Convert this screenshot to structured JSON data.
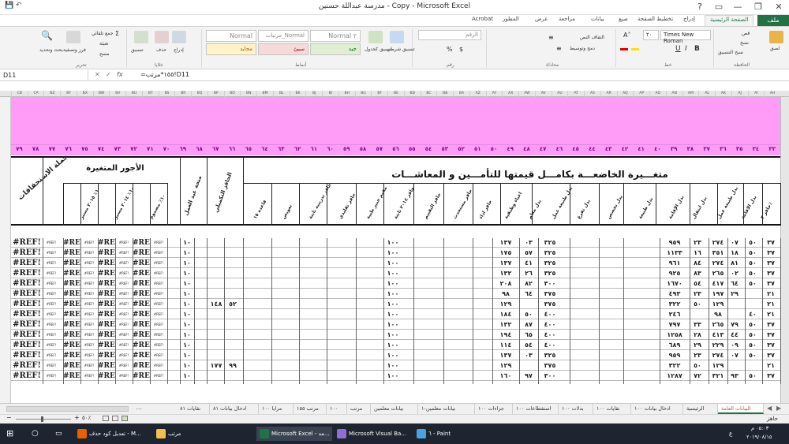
{
  "window": {
    "title": "مدرسة عبداللة حسنين - Copy - Microsoft Excel",
    "minimize": "—",
    "restore": "❐",
    "close": "✕",
    "help": "?",
    "ribbon_options": "▭"
  },
  "ribbon_tabs": [
    "ملف",
    "الصفحة الرئيسية",
    "إدراج",
    "تخطيط الصفحة",
    "صيغ",
    "بيانات",
    "مراجعة",
    "عرض",
    "المطور",
    "Acrobat"
  ],
  "ribbon": {
    "clipboard": {
      "label": "الحافظة",
      "paste": "لصق",
      "cut": "قص",
      "copy": "نسخ",
      "format_painter": "نسخ التنسيق"
    },
    "font": {
      "label": "خط",
      "name": "Times New Roman",
      "size": "٢٠"
    },
    "alignment": {
      "label": "محاذاة",
      "wrap": "التفاف النص",
      "merge": "دمج وتوسيط"
    },
    "number": {
      "label": "رقم",
      "format": "الرقم"
    },
    "styles": {
      "label": "أنماط",
      "conditional": "تنسيق شرطي",
      "as_table": "تنسيق كجدول",
      "normal": "Normal",
      "normal_2": "Normal ٢",
      "normal_salaries": "مرتبات_Normal",
      "good": "جيد",
      "bad": "سيئ",
      "neutral": "محايد"
    },
    "cells": {
      "label": "خلايا",
      "insert": "إدراج",
      "delete": "حذف",
      "format": "تنسيق"
    },
    "editing": {
      "label": "تحرير",
      "autosum": "جمع تلقائي",
      "fill": "تعبئة",
      "clear": "مسح",
      "sort": "فرز وتصفية",
      "find": "بحث وتحديد"
    }
  },
  "formula_bar": {
    "name_box": "D11",
    "formula": "=١٥٥*مرتب!D11",
    "fx": "fx"
  },
  "column_letters": [
    "AH",
    "AI",
    "AJ",
    "AK",
    "AL",
    "AM",
    "AN",
    "AO",
    "AP",
    "AQ",
    "AR",
    "AS",
    "AT",
    "AU",
    "AV",
    "AW",
    "AX",
    "AY",
    "AZ",
    "BA",
    "BB",
    "BC",
    "BD",
    "BE",
    "BF",
    "BG",
    "BH",
    "BI",
    "BJ",
    "BK",
    "BL",
    "BM",
    "BN",
    "BO",
    "BP",
    "BQ",
    "BR",
    "BS",
    "BT",
    "BU",
    "BV",
    "BW",
    "BX",
    "BY",
    "BZ",
    "CA",
    "CB"
  ],
  "col_numbers": [
    "٣٣",
    "٣٤",
    "٣٥",
    "٣٦",
    "٣٧",
    "٣٨",
    "٣٩",
    "٤٠",
    "٤١",
    "٤٢",
    "٤٣",
    "٤٤",
    "٤٥",
    "٤٦",
    "٤٧",
    "٤٨",
    "٤٩",
    "٥٠",
    "٥١",
    "٥٢",
    "٥٣",
    "٥٤",
    "٥٥",
    "٥٦",
    "٥٧",
    "٥٨",
    "٥٩",
    "٦٠",
    "٦١",
    "٦٢",
    "٦٣",
    "٦٤",
    "٦٥",
    "٦٦",
    "٦٧",
    "٦٨",
    "٦٩",
    "٧٠",
    "٧١",
    "٧٢",
    "٧٣",
    "٧٤",
    "٧٥",
    "٧٦",
    "٧٧",
    "٧٨",
    "٧٩"
  ],
  "header": {
    "main_title": "متغـــيرة الخاضعـــة بكامـــل قيمتها للتأمـــين و المعاشـــات",
    "variable_wages": "الأجور المتغيرة",
    "total_benefits": "جملة الاستحقاقات",
    "teaching_grant": "منحة عيد العمل",
    "incentive": "الحافز التكميلي",
    "subcols": [
      "حافز ٣٪",
      "بدل الاقامة",
      "بدل طبيعة عمل",
      "بدل انتقال",
      "بدل الإقامة",
      "بدل طبيعة",
      "بدل تخصص",
      "بدل تفرغ",
      "بدل طبيعة عمل",
      "بدل معلم",
      "اعباء وظيفية",
      "حافز اداء",
      "حافز مستحدث",
      "حافز التقييم",
      "حافز ٢٠١٤ ثابتة",
      "مقيم خبير طبية",
      "حافز تقليدي",
      "حافز تدريبية ثابتة",
      "تعويض",
      "قاعدة ١٥",
      "حافز تطوير",
      "حافز خاص",
      "حافز امتحانات",
      "حافز ريفي"
    ],
    "wage_subcols": [
      "١٠٪ مضموم",
      "١٠٪ ٢٠١٤ مسير",
      "١٠٪ ٢٠١٥ مسير"
    ]
  },
  "rows": [
    {
      "a": "٣٧",
      "b": "٥٠",
      "c": "٢٧٤",
      "d": "٠٧",
      "e": "٩٥٩",
      "f": "٢٣",
      "g": "٣٢٥",
      "h": "٠٣",
      "i": "١٣٧",
      "bonus": "١٠٠",
      "grant": "١٠",
      "inc": "",
      "inc2": ""
    },
    {
      "a": "٣٧",
      "b": "٥٠",
      "c": "٣٥١",
      "d": "١٨",
      "e": "١١٣٣",
      "f": "١٦",
      "g": "٣٢٥",
      "h": "٥٧",
      "i": "١٧٥",
      "bonus": "١٠٠",
      "grant": "١٠",
      "inc": "",
      "inc2": ""
    },
    {
      "a": "٣٧",
      "b": "٥٠",
      "c": "٢٧٤",
      "d": "٨١",
      "e": "٩٦١",
      "f": "٨٤",
      "g": "٣٢٥",
      "h": "٤١",
      "i": "١٣٧",
      "bonus": "١٠٠",
      "grant": "١٠",
      "inc": "",
      "inc2": ""
    },
    {
      "a": "٣٧",
      "b": "٥٠",
      "c": "٢٦٥",
      "d": "٠٢",
      "e": "٩٢٥",
      "f": "٨٣",
      "g": "٣٢٥",
      "h": "٢٦",
      "i": "١٣٢",
      "bonus": "١٠٠",
      "grant": "١٠",
      "inc": "",
      "inc2": ""
    },
    {
      "a": "٣٧",
      "b": "٥٠",
      "c": "٤١٧",
      "d": "٦٤",
      "e": "١٦٧٠",
      "f": "٥٤",
      "g": "٣٠٠",
      "h": "٨٢",
      "i": "٢٠٨",
      "bonus": "١٠٠",
      "grant": "١٠",
      "inc": "",
      "inc2": ""
    },
    {
      "a": "٢١",
      "b": "",
      "c": "١٩٧",
      "d": "٢٩",
      "e": "٤٩٣",
      "f": "٢٣",
      "g": "٣٧٥",
      "h": "٦٤",
      "i": "٩٨",
      "bonus": "١٠٠",
      "grant": "١٠",
      "inc": "",
      "inc2": ""
    },
    {
      "a": "٢١",
      "b": "",
      "c": "١٢٩",
      "d": "",
      "e": "٣٢٢",
      "f": "٥٠",
      "g": "٣٧٥",
      "h": "",
      "i": "١٢٩",
      "bonus": "١٠٠",
      "grant": "١٠",
      "inc": "٥٢",
      "inc2": "١٤٨"
    },
    {
      "a": "٢١",
      "b": "٤٠",
      "c": "٩٨",
      "d": "",
      "e": "٢٤٦",
      "f": "",
      "g": "٤٠٠",
      "h": "٥٠",
      "i": "١٨٤",
      "bonus": "١٠٠",
      "grant": "١٠",
      "inc": "",
      "inc2": ""
    },
    {
      "a": "٣٧",
      "b": "٥٠",
      "c": "٢٦٥",
      "d": "٧٩",
      "e": "٧٩٧",
      "f": "٣٣",
      "g": "٤٠٠",
      "h": "٨٧",
      "i": "١٣٢",
      "bonus": "١٠٠",
      "grant": "١٠",
      "inc": "",
      "inc2": ""
    },
    {
      "a": "٣٧",
      "b": "٥٠",
      "c": "٤١٣",
      "d": "٤٤",
      "e": "١٢٥٨",
      "f": "٢٨",
      "g": "٤٠٠",
      "h": "٦٥",
      "i": "١٩٤",
      "bonus": "١٠٠",
      "grant": "١٠",
      "inc": "",
      "inc2": ""
    },
    {
      "a": "٣٧",
      "b": "٥٠",
      "c": "٢٢٩",
      "d": "٠٩",
      "e": "٦٨٩",
      "f": "٢٩",
      "g": "٤٠٠",
      "h": "٥٤",
      "i": "١١٤",
      "bonus": "١٠٠",
      "grant": "١٠",
      "inc": "",
      "inc2": ""
    },
    {
      "a": "٣٧",
      "b": "٥٠",
      "c": "٢٧٤",
      "d": "٠٧",
      "e": "٩٥٩",
      "f": "٢٣",
      "g": "٣٢٥",
      "h": "٠٣",
      "i": "١٣٧",
      "bonus": "١٠٠",
      "grant": "١٠",
      "inc": "",
      "inc2": ""
    },
    {
      "a": "٢١",
      "b": "",
      "c": "١٢٩",
      "d": "",
      "e": "٣٢٢",
      "f": "٥٠",
      "g": "٣٧٥",
      "h": "",
      "i": "١٢٩",
      "bonus": "١٠٠",
      "grant": "١٠",
      "inc": "٩٩",
      "inc2": "١٧٧"
    },
    {
      "a": "٣٧",
      "b": "٥٠",
      "c": "٣٢١",
      "d": "٩٣",
      "e": "١٢٨٧",
      "f": "٧٢",
      "g": "٣٠٠",
      "h": "٩٧",
      "i": "١٦٠",
      "bonus": "١٠٠",
      "grant": "١٠",
      "inc": "",
      "inc2": ""
    }
  ],
  "ref_error": "#REF!",
  "sheet_tabs": [
    "البيانات العامة",
    "الرئيسية",
    "ادخال بيانات ١٠٠",
    "نقايات ١٠٠",
    "بدلات ١٠٠",
    "استقطاعات ١٠٠",
    "جزاءات ١٠٠",
    "بيانات معلمين-١",
    "بيانات معلمين",
    "مرتب",
    "١٠٠",
    "مرتب ١٥٥",
    "مرايا ١٠٠",
    "ادخال بيانات ٨١",
    "نقايات ٨١"
  ],
  "active_sheet": "البيانات العامة",
  "status": {
    "ready": "جاهز",
    "zoom": "٥٠٪"
  },
  "taskbar": {
    "items": [
      "تعديل كود حذف - M...",
      "مرتب",
      "Microsoft Excel - مد...",
      "Microsoft Visual Ba...",
      "٦ - Paint"
    ],
    "time": "٠٥:٠٣ م",
    "date": "٢٠١٩/٠٨/١٥",
    "lang": "ع"
  }
}
